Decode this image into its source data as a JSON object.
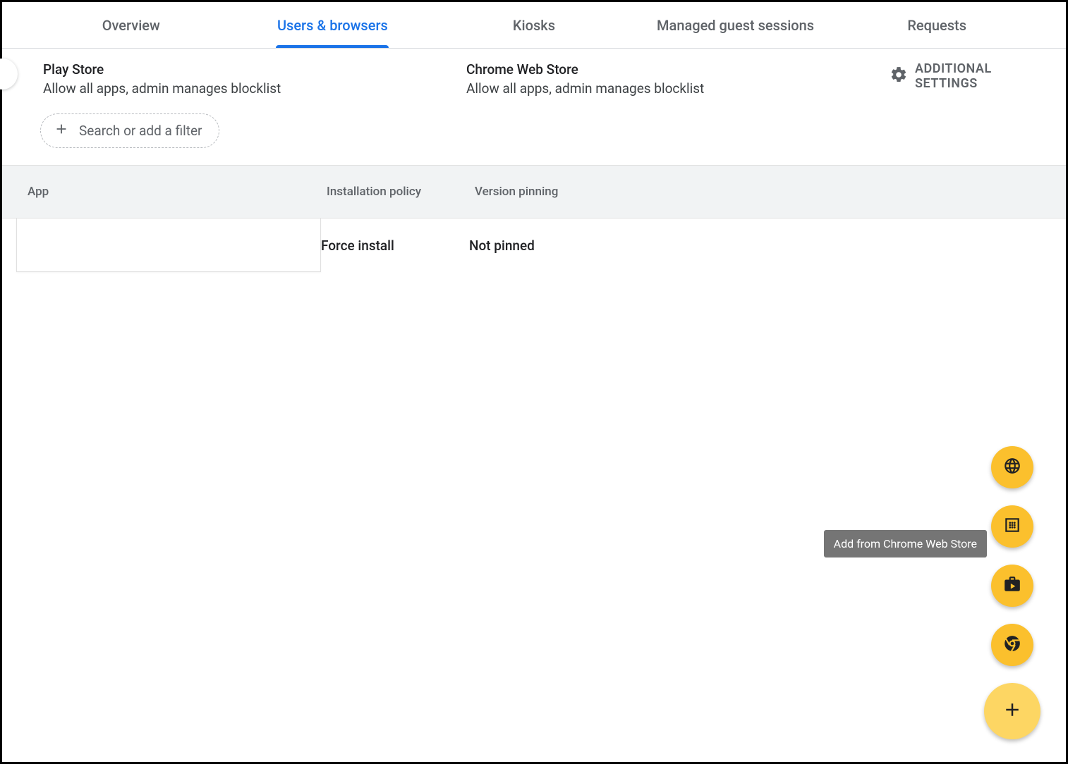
{
  "tabs": {
    "overview": "Overview",
    "users_browsers": "Users & browsers",
    "kiosks": "Kiosks",
    "managed_guest": "Managed guest sessions",
    "requests": "Requests"
  },
  "stores": {
    "play": {
      "title": "Play Store",
      "subtitle": "Allow all apps, admin manages blocklist"
    },
    "cws": {
      "title": "Chrome Web Store",
      "subtitle": "Allow all apps, admin manages blocklist"
    }
  },
  "additional_settings_label": "ADDITIONAL SETTINGS",
  "filter_placeholder": "Search or add a filter",
  "columns": {
    "app": "App",
    "policy": "Installation policy",
    "version": "Version pinning"
  },
  "rows": [
    {
      "app": "",
      "policy": "Force install",
      "version": "Not pinned"
    }
  ],
  "fab_tooltip": "Add from Chrome Web Store"
}
